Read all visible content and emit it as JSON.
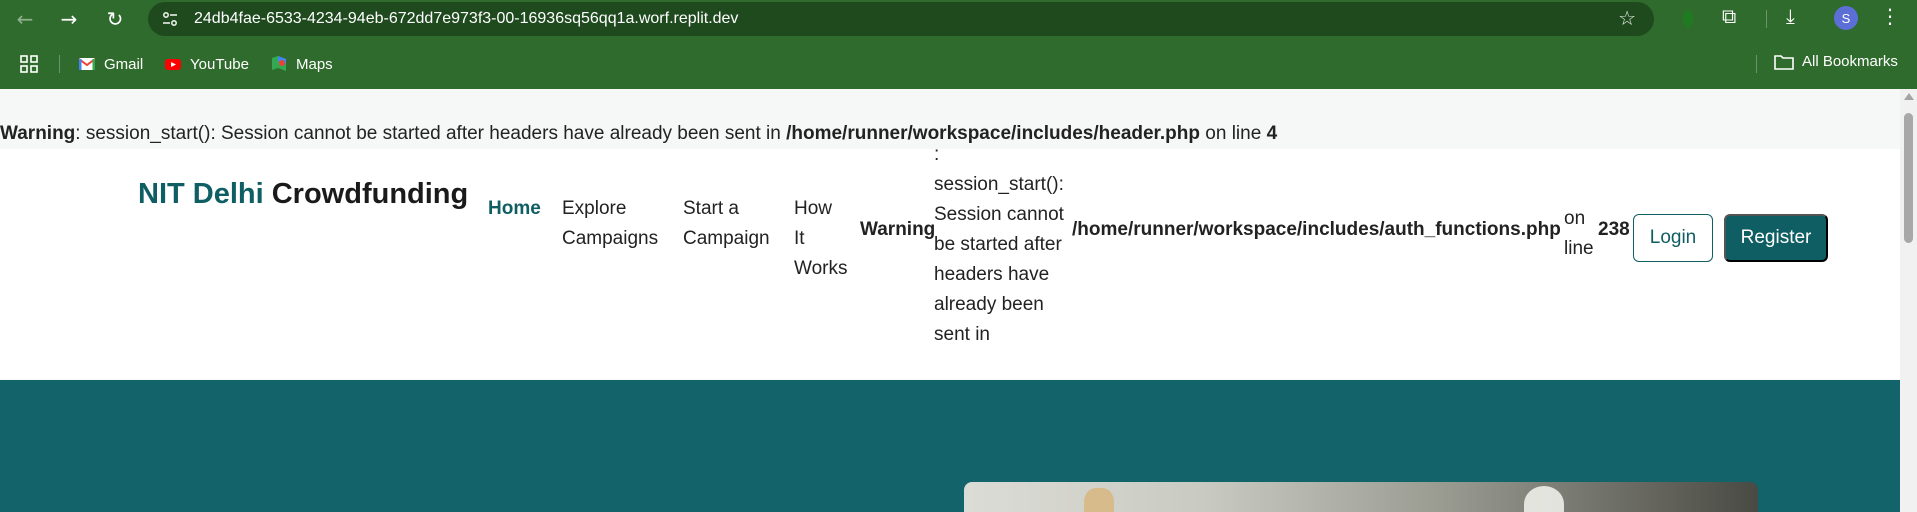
{
  "browser": {
    "url": "24db4fae-6533-4234-94eb-672dd7e973f3-00-16936sq56qq1a.worf.replit.dev",
    "profile_initial": "S",
    "icons": {
      "back": "arrow-left-icon",
      "forward": "arrow-right-icon",
      "reload": "reload-icon",
      "site_info": "site-info-icon",
      "bookmark_star": "star-icon",
      "extension": "puzzle-icon",
      "download": "download-icon",
      "menu": "more-vertical-icon"
    },
    "bookmarks": [
      {
        "label": "Gmail",
        "icon": "gmail-icon"
      },
      {
        "label": "YouTube",
        "icon": "youtube-icon"
      },
      {
        "label": "Maps",
        "icon": "maps-icon"
      }
    ],
    "all_bookmarks_label": "All Bookmarks"
  },
  "page": {
    "top_warning": {
      "label": "Warning",
      "message": ": session_start(): Session cannot be started after headers have already been sent in",
      "path": "/home/runner/workspace/includes/header.php",
      "on_line": "on line",
      "line": "4"
    },
    "brand": {
      "accent": "NIT Delhi",
      "rest": " Crowdfunding"
    },
    "nav": {
      "home": "Home",
      "explore": "Explore Campaigns",
      "start": "Start a Campaign",
      "how": "How It Works"
    },
    "header_warning": {
      "label": "Warning",
      "message": ": session_start(): Session cannot be started after headers have already been sent in",
      "path": "/home/runner/workspace/includes/auth_functions.php",
      "on_line": "on line",
      "line": "238"
    },
    "buttons": {
      "login": "Login",
      "register": "Register"
    },
    "colors": {
      "brand_teal": "#0f5e63",
      "chrome_green": "#2f6b2c",
      "hero_bg": "#12636a"
    }
  }
}
